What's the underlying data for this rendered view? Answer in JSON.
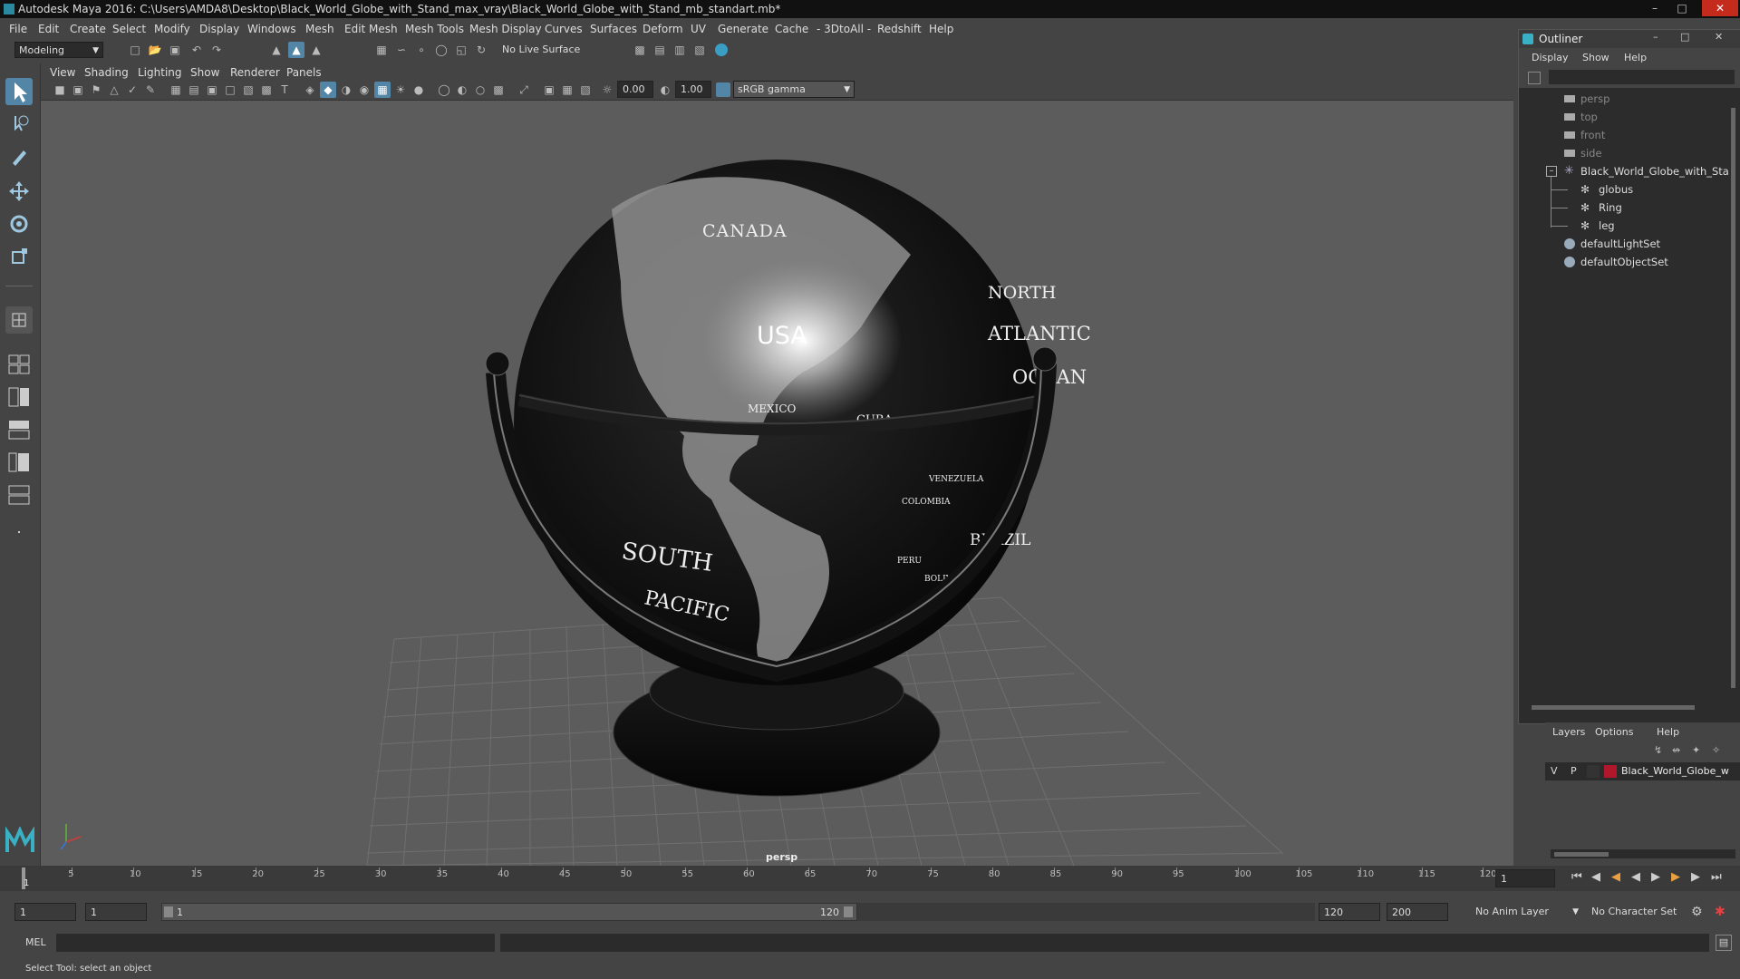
{
  "app": {
    "title": "Autodesk Maya 2016: C:\\Users\\AMDA8\\Desktop\\Black_World_Globe_with_Stand_max_vray\\Black_World_Globe_with_Stand_mb_standart.mb*"
  },
  "menubar": {
    "items": [
      "File",
      "Edit",
      "Create",
      "Select",
      "Modify",
      "Display",
      "Windows",
      "Mesh",
      "Edit Mesh",
      "Mesh Tools",
      "Mesh Display",
      "Curves",
      "Surfaces",
      "Deform",
      "UV",
      "Generate",
      "Cache",
      "- 3DtoAll -",
      "Redshift",
      "Help"
    ]
  },
  "shelf": {
    "mode": "Modeling",
    "live_surface": "No Live Surface"
  },
  "viewport": {
    "menu": [
      "View",
      "Shading",
      "Lighting",
      "Show",
      "Renderer",
      "Panels"
    ],
    "exposure": "0.00",
    "gamma": "1.00",
    "color_space": "sRGB gamma",
    "camera_label": "persp",
    "globe_labels": {
      "canada": "CANADA",
      "usa": "USA",
      "mexico": "MEXICO",
      "cuba": "CUBA",
      "north": "NORTH",
      "atlantic": "ATLANTIC",
      "ocean": "OCEAN",
      "venezuela": "VENEZUELA",
      "colombia": "COLOMBIA",
      "brazil": "BRAZIL",
      "peru": "PERU",
      "bolivia": "BOLIVIA",
      "south": "SOUTH",
      "pacific": "PACIFIC"
    }
  },
  "outliner": {
    "title": "Outliner",
    "menu": [
      "Display",
      "Show",
      "Help"
    ],
    "cameras": [
      "persp",
      "top",
      "front",
      "side"
    ],
    "group": "Black_World_Globe_with_Stan",
    "children": [
      "globus",
      "Ring",
      "leg"
    ],
    "sets": [
      "defaultLightSet",
      "defaultObjectSet"
    ]
  },
  "layers": {
    "menu": [
      "Layers",
      "Options",
      "Help"
    ],
    "visible": "V",
    "playback": "P",
    "layer_name": "Black_World_Globe_w",
    "layer_color": "#b0172a"
  },
  "timeline": {
    "ticks": [
      "5",
      "10",
      "15",
      "20",
      "25",
      "30",
      "35",
      "40",
      "45",
      "50",
      "55",
      "60",
      "65",
      "70",
      "75",
      "80",
      "85",
      "90",
      "95",
      "100",
      "105",
      "110",
      "115",
      "120"
    ],
    "start_tick": "1",
    "current_frame": "1"
  },
  "range": {
    "start": "1",
    "anim_start": "1",
    "slider_start": "1",
    "slider_end": "120",
    "end": "120",
    "anim_end": "200",
    "anim_layer": "No Anim Layer",
    "character_set": "No Character Set"
  },
  "command": {
    "label": "MEL"
  },
  "status": {
    "help_line": "Select Tool: select an object"
  },
  "colors": {
    "accent": "#5285a6",
    "layer_red": "#b0172a"
  }
}
